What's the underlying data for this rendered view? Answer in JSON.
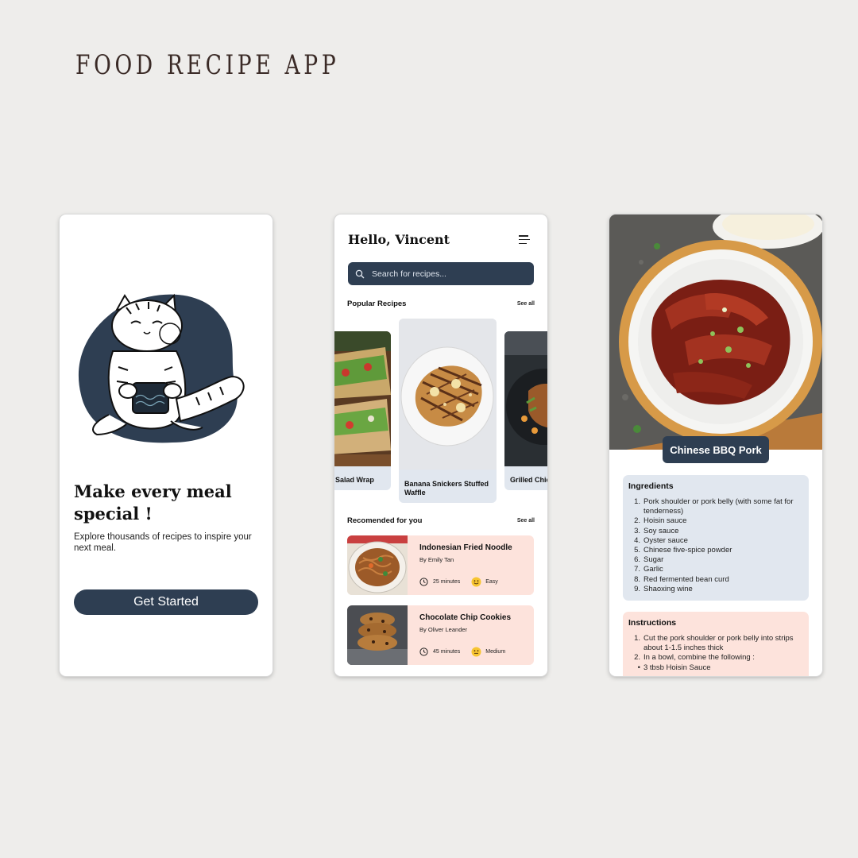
{
  "heading": "FOOD RECIPE APP",
  "colors": {
    "navy": "#2e3e52",
    "card_blue": "#e1e7ef",
    "card_peach": "#fde3dc",
    "background": "#eeedeb"
  },
  "welcome": {
    "title_line1": "Make every meal",
    "title_line2": "special !",
    "subtitle": "Explore thousands of recipes to inspire your next meal.",
    "cta_label": "Get Started",
    "illustration": "cat-holding-bowl-illustration"
  },
  "home": {
    "greeting": "Hello, Vincent",
    "menu_icon": "hamburger-menu-icon",
    "search_placeholder": "Search for recipes...",
    "popular_title": "Popular Recipes",
    "popular_see_all": "See all",
    "popular": [
      {
        "name": "Salad Wrap"
      },
      {
        "name": "Banana Snickers Stuffed Waffle"
      },
      {
        "name": "Grilled Chic"
      }
    ],
    "recommended_title": "Recomended for you",
    "recommended_see_all": "See all",
    "recommended": [
      {
        "title": "Indonesian Fried Noodle",
        "author": "By Emily Tan",
        "time": "25 minutes",
        "difficulty": "Easy"
      },
      {
        "title": "Chocolate Chip Cookies",
        "author": "By Oliver Leander",
        "time": "45 minutes",
        "difficulty": "Medium"
      }
    ]
  },
  "detail": {
    "dish_name": "Chinese BBQ Pork",
    "ingredients_title": "Ingredients",
    "ingredients": [
      "Pork shoulder or pork belly (with some fat for tenderness)",
      "Hoisin sauce",
      "Soy sauce",
      "Oyster sauce",
      "Chinese five-spice powder",
      "Sugar",
      "Garlic",
      "Red fermented bean curd",
      "Shaoxing wine"
    ],
    "instructions_title": "Instructions",
    "instructions": [
      {
        "num": "1.",
        "text": "Cut the pork shoulder or pork belly into strips about 1-1.5 inches thick"
      },
      {
        "num": "2.",
        "text": "In a bowl, combine the following :"
      },
      {
        "num": "•",
        "text": "3 tbsb Hoisin Sauce"
      }
    ]
  }
}
